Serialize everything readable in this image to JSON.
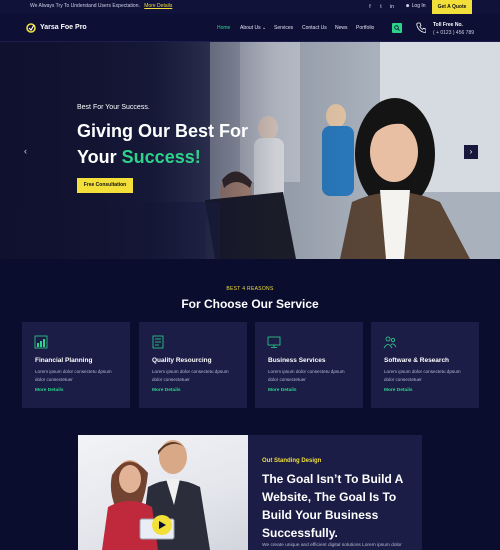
{
  "topbar": {
    "message": "We Always Try To Understand Users Expectation.",
    "message_link": "More Details",
    "social": [
      "f",
      "t",
      "in"
    ],
    "login": "Log In",
    "quote_button": "Get A Quote"
  },
  "navbar": {
    "logo_text": "Yarsa Foe Pro",
    "items": [
      "Home",
      "About Us",
      "Services",
      "Contact Us",
      "News",
      "Portfolio"
    ],
    "active_item": "Home",
    "toll_free_label": "Toll Free No.",
    "phone": "( + 0123 ) 456 789"
  },
  "hero": {
    "subtitle": "Best For Your Success.",
    "title_line1": "Giving Our Best For",
    "title_line2_prefix": "Your ",
    "title_line2_accent": "Success!",
    "button": "Free Consultation",
    "prev_arrow": "‹",
    "next_arrow": "›"
  },
  "services": {
    "label": "BEST 4 REASONS",
    "title": "For Choose Our Service",
    "cards": [
      {
        "title": "Financial Planning",
        "desc": "Lorem ipsum dolor consectetu dpsum dolor consectetuer",
        "more": "More Details",
        "icon": "chart-icon"
      },
      {
        "title": "Quality Resourcing",
        "desc": "Lorem ipsum dolor consectetu dpsum dolor consectetuer",
        "more": "More Details",
        "icon": "document-icon"
      },
      {
        "title": "Business Services",
        "desc": "Lorem ipsum dolor consectetu dpsum dolor consectetuer",
        "more": "More Details",
        "icon": "monitor-icon"
      },
      {
        "title": "Software & Research",
        "desc": "Lorem ipsum dolor consectetu dpsum dolor consectetuer",
        "more": "More Details",
        "icon": "team-icon"
      }
    ]
  },
  "feature": {
    "label": "Out Standing Design",
    "title": "The Goal Isn’t To Build A Website, The Goal Is To Build Your Business Successfully.",
    "desc": "We create unique and efficient digital solutions Lorem ipsum dolor"
  },
  "colors": {
    "background": "#0b0d2e",
    "accent_green": "#2dd38b",
    "accent_yellow": "#f2df3a",
    "card": "#1b1d46"
  }
}
